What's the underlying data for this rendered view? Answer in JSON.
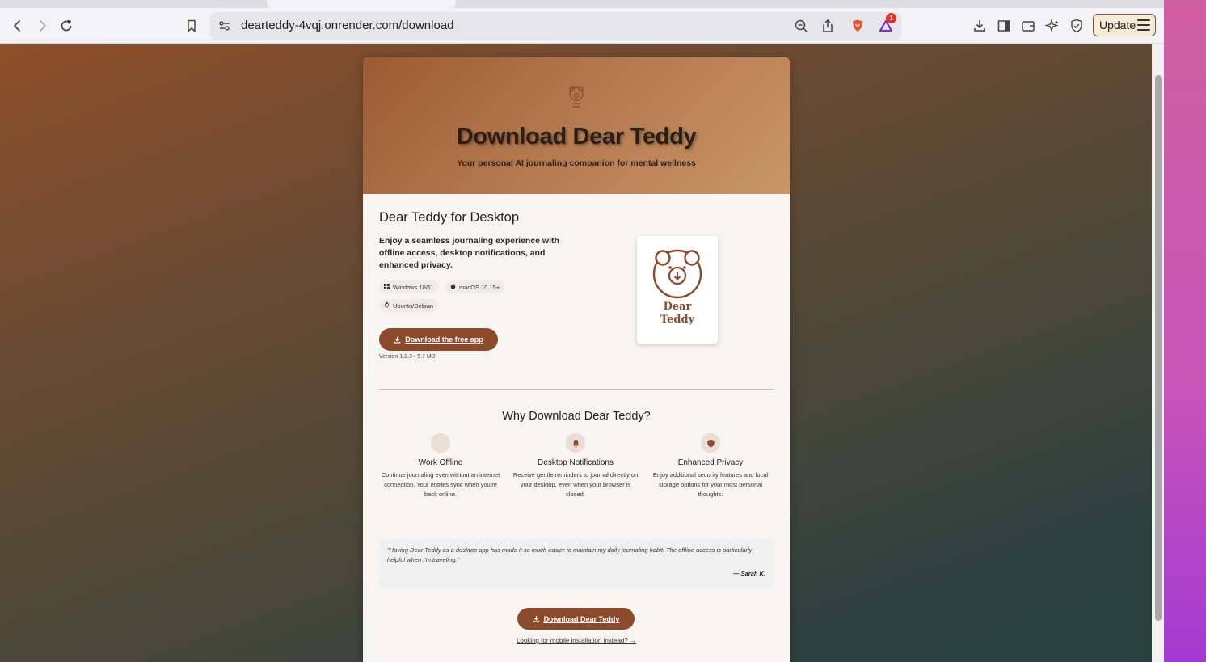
{
  "browser": {
    "url": "dearteddy-4vqj.onrender.com/download",
    "update_label": "Update",
    "notification_count": "1"
  },
  "hero": {
    "title": "Download Dear Teddy",
    "subtitle": "Your personal AI journaling companion for mental wellness",
    "logo_icon": "bear-logo-icon"
  },
  "desktop": {
    "heading": "Dear Teddy for Desktop",
    "description": "Enjoy a seamless journaling experience with offline access, desktop notifications, and enhanced privacy.",
    "platforms": [
      {
        "label": "Windows 10/11",
        "icon": "windows-icon"
      },
      {
        "label": "macOS 10.15+",
        "icon": "apple-icon"
      },
      {
        "label": "Ubuntu/Debian",
        "icon": "linux-icon"
      }
    ],
    "download_label": "Download the free app",
    "version": "Version 1.2.3 • 5.7 MB",
    "app_name_line1": "Dear",
    "app_name_line2": "Teddy"
  },
  "why": {
    "heading": "Why Download Dear Teddy?",
    "features": [
      {
        "title": "Work Offline",
        "desc": "Continue journaling even without an internet connection. Your entries sync when you're back online.",
        "icon": "offline-icon"
      },
      {
        "title": "Desktop Notifications",
        "desc": "Receive gentle reminders to journal directly on your desktop, even when your browser is closed.",
        "icon": "bell-icon"
      },
      {
        "title": "Enhanced Privacy",
        "desc": "Enjoy additional security features and local storage options for your most personal thoughts.",
        "icon": "shield-icon"
      }
    ]
  },
  "testimonial": {
    "quote": "\"Having Dear Teddy as a desktop app has made it so much easier to maintain my daily journaling habit. The offline access is particularly helpful when I'm traveling.\"",
    "author": "— Sarah K."
  },
  "cta": {
    "download_label": "Download Dear Teddy",
    "mobile_link": "Looking for mobile installation instead?",
    "mobile_arrow": "→"
  },
  "colors": {
    "brand": "#8b4a2b",
    "hero_start": "#9b5a33",
    "hero_end": "#c99666"
  }
}
